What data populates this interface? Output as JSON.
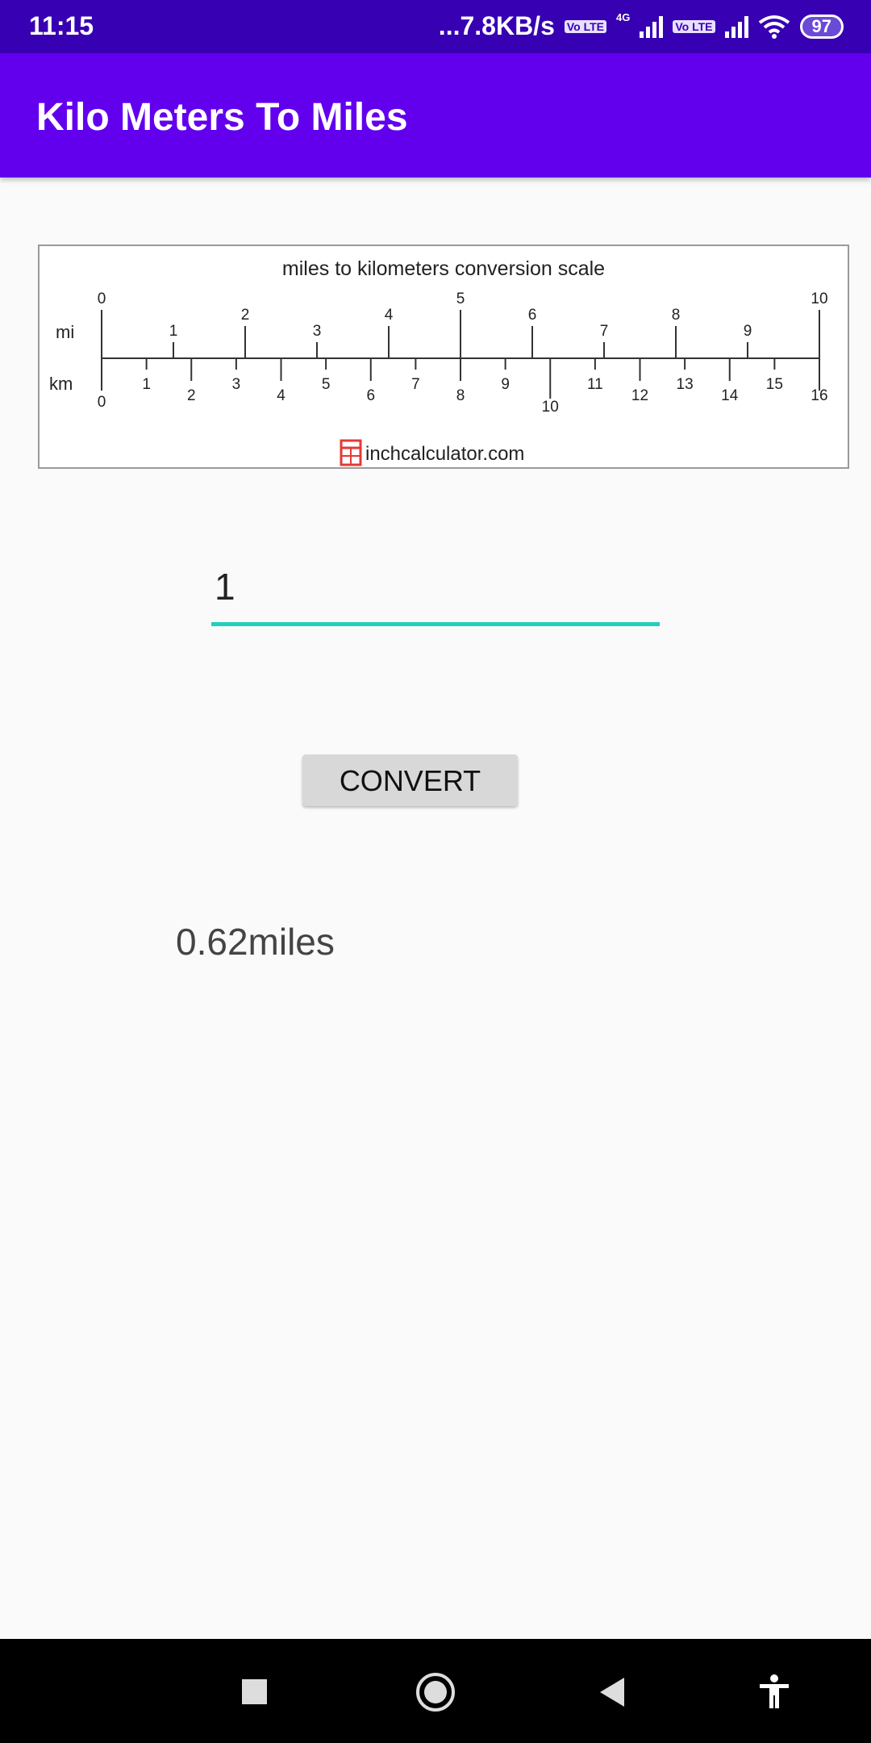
{
  "status_bar": {
    "time": "11:15",
    "network_speed": "...7.8KB/s",
    "volte_badge": "Vo LTE",
    "network_type": "4G",
    "battery": "97"
  },
  "app_bar": {
    "title": "Kilo Meters To Miles"
  },
  "scale_image": {
    "title": "miles to kilometers conversion scale",
    "mi_label": "mi",
    "km_label": "km",
    "mi_ticks": [
      "0",
      "1",
      "2",
      "3",
      "4",
      "5",
      "6",
      "7",
      "8",
      "9",
      "10"
    ],
    "km_ticks": [
      "0",
      "1",
      "2",
      "3",
      "4",
      "5",
      "6",
      "7",
      "8",
      "9",
      "10",
      "11",
      "12",
      "13",
      "14",
      "15",
      "16"
    ],
    "credit": "inchcalculator.com",
    "logo_color": "#e53935"
  },
  "input": {
    "value": "1"
  },
  "convert_button": {
    "label": "CONVERT"
  },
  "result": {
    "text": "0.62miles"
  },
  "colors": {
    "status_bar": "#3700b3",
    "app_bar": "#6200ee",
    "input_underline": "#1fcfc0"
  }
}
